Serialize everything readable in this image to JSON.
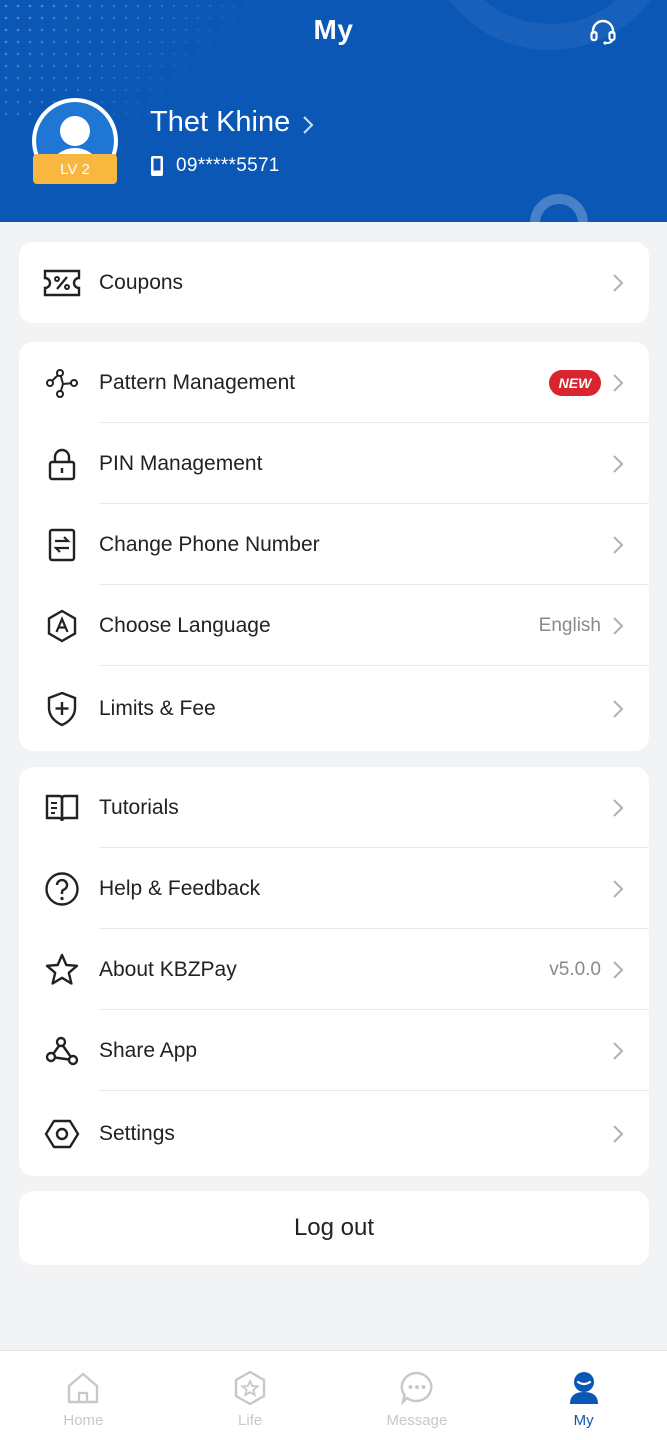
{
  "header": {
    "title": "My",
    "user_name": "Thet Khine",
    "phone": "09*****5571",
    "level": "LV 2"
  },
  "colors": {
    "brand_blue": "#0a57b5",
    "badge_yellow": "#f8b73e",
    "new_red": "#d9252f"
  },
  "cards": {
    "coupons": {
      "label": "Coupons"
    },
    "security": {
      "pattern": {
        "label": "Pattern Management",
        "badge": "NEW"
      },
      "pin": {
        "label": "PIN Management"
      },
      "change_phone": {
        "label": "Change Phone Number"
      },
      "language": {
        "label": "Choose Language",
        "value": "English"
      },
      "limits": {
        "label": "Limits & Fee"
      }
    },
    "general": {
      "tutorials": {
        "label": "Tutorials"
      },
      "help": {
        "label": "Help & Feedback"
      },
      "about": {
        "label": "About KBZPay",
        "value": "v5.0.0"
      },
      "share": {
        "label": "Share App"
      },
      "settings": {
        "label": "Settings"
      }
    }
  },
  "logout_label": "Log out",
  "bottom_nav": {
    "home": "Home",
    "life": "Life",
    "message": "Message",
    "my": "My",
    "active": "My"
  }
}
